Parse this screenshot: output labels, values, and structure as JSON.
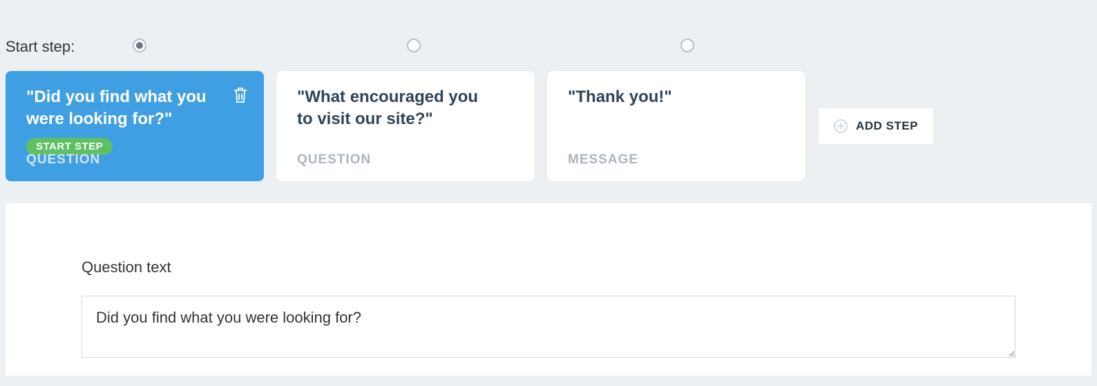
{
  "start_step_label": "Start step:",
  "steps": [
    {
      "title": "\"Did you find what you were looking for?\"",
      "type": "QUESTION",
      "start_badge": "START STEP",
      "is_start": true
    },
    {
      "title": "\"What encouraged you to visit our site?\"",
      "type": "QUESTION",
      "is_start": false
    },
    {
      "title": "\"Thank you!\"",
      "type": "MESSAGE",
      "is_start": false
    }
  ],
  "add_step_label": "ADD STEP",
  "editor": {
    "field_label": "Question text",
    "question_text": "Did you find what you were looking for?"
  }
}
